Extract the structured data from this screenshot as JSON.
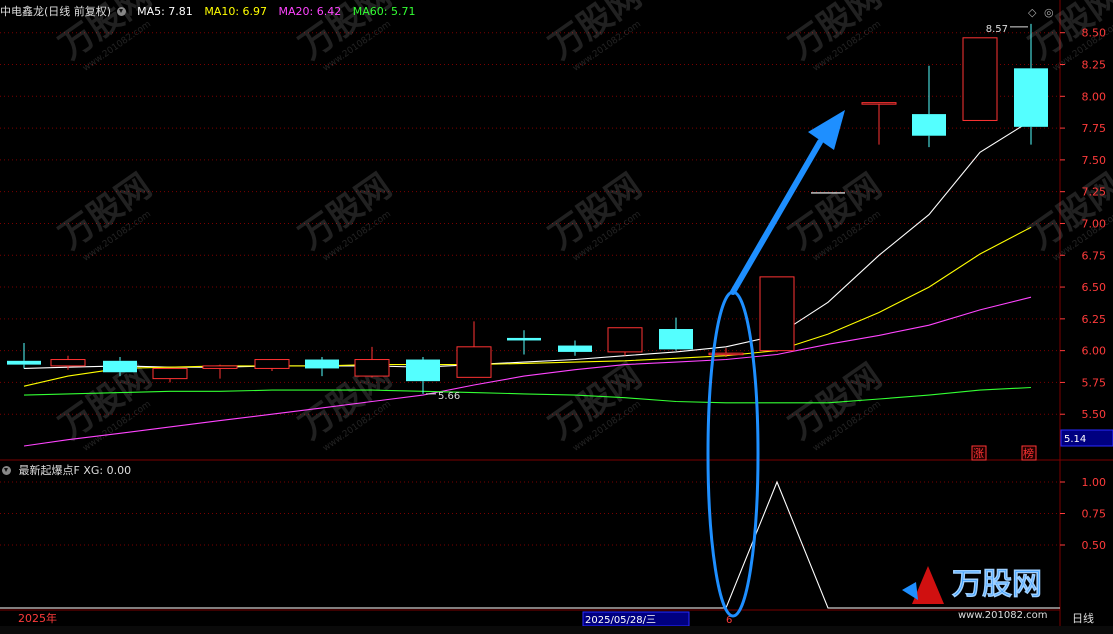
{
  "header": {
    "stock_name": "中电鑫龙(日线 前复权)",
    "indicators": [
      {
        "label": "MA5: 7.81",
        "color": "#ffffff"
      },
      {
        "label": "MA10: 6.97",
        "color": "#ffff00"
      },
      {
        "label": "MA20: 6.42",
        "color": "#ff44ff"
      },
      {
        "label": "MA60: 5.71",
        "color": "#33ff33"
      }
    ]
  },
  "sub_header": {
    "name": "最新起爆点F",
    "value": "XG: 0.00"
  },
  "annotations": {
    "high_label": "8.57",
    "low_label": "5.66",
    "price_box": "5.14",
    "tag_up": "涨",
    "tag_rank": "榜",
    "year_label": "2025年",
    "date_box": "2025/05/28/三",
    "date_num": "6",
    "period_label": "日线",
    "watermark_text": "万股网",
    "watermark_url": "www.201082.com"
  },
  "colors": {
    "up": "#ff3333",
    "down": "#54ffff",
    "grid": "#7a0000",
    "axis_text": "#ff3b3b",
    "arrow": "#1e8fff"
  },
  "chart_data": [
    {
      "type": "candlestick",
      "title": "",
      "ylim": [
        5.14,
        8.6
      ],
      "y_ticks": [
        "8.50",
        "8.25",
        "8.00",
        "7.75",
        "7.50",
        "7.25",
        "7.00",
        "6.75",
        "6.50",
        "6.25",
        "6.00",
        "5.75",
        "5.50"
      ],
      "candles": [
        {
          "open": 5.92,
          "high": 6.06,
          "low": 5.86,
          "close": 5.89
        },
        {
          "open": 5.88,
          "high": 5.96,
          "low": 5.85,
          "close": 5.93
        },
        {
          "open": 5.92,
          "high": 5.95,
          "low": 5.8,
          "close": 5.83
        },
        {
          "open": 5.78,
          "high": 5.86,
          "low": 5.75,
          "close": 5.86
        },
        {
          "open": 5.86,
          "high": 5.89,
          "low": 5.78,
          "close": 5.88
        },
        {
          "open": 5.86,
          "high": 5.93,
          "low": 5.84,
          "close": 5.93
        },
        {
          "open": 5.93,
          "high": 5.95,
          "low": 5.8,
          "close": 5.86
        },
        {
          "open": 5.8,
          "high": 6.03,
          "low": 5.79,
          "close": 5.93
        },
        {
          "open": 5.93,
          "high": 5.95,
          "low": 5.66,
          "close": 5.76
        },
        {
          "open": 5.79,
          "high": 6.23,
          "low": 5.79,
          "close": 6.03
        },
        {
          "open": 6.1,
          "high": 6.16,
          "low": 5.97,
          "close": 6.08
        },
        {
          "open": 6.04,
          "high": 6.08,
          "low": 5.96,
          "close": 5.99
        },
        {
          "open": 5.99,
          "high": 6.18,
          "low": 5.96,
          "close": 6.18
        },
        {
          "open": 6.17,
          "high": 6.26,
          "low": 6.0,
          "close": 6.01
        },
        {
          "open": 5.97,
          "high": 6.02,
          "low": 5.95,
          "close": 5.98
        },
        {
          "open": 6.0,
          "high": 6.58,
          "low": 5.99,
          "close": 6.58
        },
        {
          "open": 7.24,
          "high": 7.24,
          "low": 7.24,
          "close": 7.24
        },
        {
          "open": 7.95,
          "high": 7.95,
          "low": 7.62,
          "close": 7.95
        },
        {
          "open": 7.86,
          "high": 8.24,
          "low": 7.6,
          "close": 7.69
        },
        {
          "open": 7.81,
          "high": 8.46,
          "low": 7.81,
          "close": 8.46
        },
        {
          "open": 8.22,
          "high": 8.57,
          "low": 7.62,
          "close": 7.76
        }
      ],
      "series": [
        {
          "name": "MA5",
          "color": "#ffffff",
          "values": [
            5.86,
            5.87,
            5.88,
            5.87,
            5.87,
            5.88,
            5.88,
            5.88,
            5.87,
            5.89,
            5.91,
            5.93,
            5.96,
            5.99,
            6.03,
            6.12,
            6.38,
            6.75,
            7.07,
            7.56,
            7.81
          ]
        },
        {
          "name": "MA10",
          "color": "#ffff00",
          "values": [
            5.72,
            5.8,
            5.86,
            5.87,
            5.88,
            5.88,
            5.88,
            5.89,
            5.89,
            5.89,
            5.9,
            5.91,
            5.92,
            5.94,
            5.96,
            6.0,
            6.13,
            6.3,
            6.5,
            6.76,
            6.97
          ]
        },
        {
          "name": "MA20",
          "color": "#ff44ff",
          "values": [
            5.25,
            5.3,
            5.35,
            5.4,
            5.45,
            5.5,
            5.55,
            5.6,
            5.65,
            5.73,
            5.8,
            5.85,
            5.89,
            5.91,
            5.93,
            5.97,
            6.05,
            6.12,
            6.2,
            6.32,
            6.42
          ]
        },
        {
          "name": "MA60",
          "color": "#33ff33",
          "values": [
            5.65,
            5.66,
            5.67,
            5.68,
            5.68,
            5.69,
            5.69,
            5.69,
            5.68,
            5.67,
            5.66,
            5.65,
            5.63,
            5.6,
            5.59,
            5.59,
            5.59,
            5.62,
            5.65,
            5.69,
            5.71
          ]
        }
      ]
    },
    {
      "type": "line",
      "title": "",
      "ylim": [
        0,
        1.1
      ],
      "y_ticks": [
        "1.00",
        "0.75",
        "0.50"
      ],
      "series": [
        {
          "name": "XG",
          "color": "#ffffff",
          "values": [
            0,
            0,
            0,
            0,
            0,
            0,
            0,
            0,
            0,
            0,
            0,
            0,
            0,
            0,
            0,
            1,
            0,
            0,
            0,
            0,
            0
          ]
        }
      ]
    }
  ]
}
